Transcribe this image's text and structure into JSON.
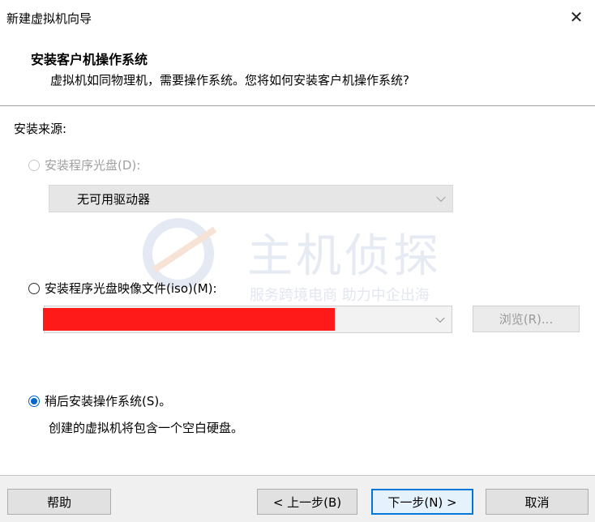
{
  "window": {
    "title": "新建虚拟机向导",
    "close_icon": "close-icon"
  },
  "header": {
    "title": "安装客户机操作系统",
    "description": "虚拟机如同物理机，需要操作系统。您将如何安装客户机操作系统?"
  },
  "install_source": {
    "label": "安装来源:",
    "disc_option": {
      "label": "安装程序光盘(D):",
      "enabled": false,
      "checked": false,
      "drive_select_value": "无可用驱动器"
    },
    "iso_option": {
      "label": "安装程序光盘映像文件(iso)(M):",
      "enabled": true,
      "checked": false,
      "browse_label": "浏览(R)..."
    },
    "later_option": {
      "label": "稍后安装操作系统(S)。",
      "checked": true,
      "description": "创建的虚拟机将包含一个空白硬盘。"
    }
  },
  "watermark": {
    "text": "主机侦探",
    "subtext": "服务跨境电商 助力中企出海"
  },
  "footer": {
    "help_label": "帮助",
    "back_label": "< 上一步(B)",
    "next_label": "下一步(N) >",
    "cancel_label": "取消"
  },
  "colors": {
    "accent": "#0078d7",
    "radio_checked": "#0066cc",
    "redaction": "#ff1a1a",
    "footer_bg": "#f0f0f0"
  }
}
